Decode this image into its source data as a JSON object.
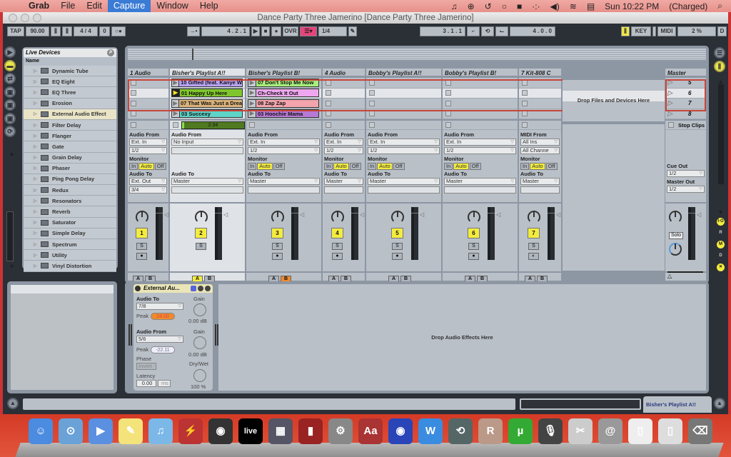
{
  "menubar": {
    "app": "Grab",
    "items": [
      "File",
      "Edit",
      "Capture",
      "Window",
      "Help"
    ],
    "active_item": "Capture",
    "clock": "Sun 10:22 PM",
    "battery": "(Charged)"
  },
  "window": {
    "title": "Dance Party Three Jamerino  [Dance Party Three Jamerino]"
  },
  "control_bar": {
    "tap": "TAP",
    "tempo": "90.00",
    "signature": "4 / 4",
    "metronome_value": "0",
    "follow_icon": "→•",
    "position": "4 .  2 .  1",
    "overdub": "OVR",
    "quantize": "1/4",
    "loop_start": "3 .  1 .  1",
    "loop_length": "4 .  0 .  0",
    "key": "KEY",
    "midi": "MIDI",
    "cpu": "2 %",
    "disk": "D"
  },
  "browser": {
    "title": "Live Devices",
    "column": "Name",
    "selected": "External Audio Effect",
    "items": [
      "Dynamic Tube",
      "EQ Eight",
      "EQ Three",
      "Erosion",
      "External Audio Effect",
      "Filter Delay",
      "Flanger",
      "Gate",
      "Grain Delay",
      "Phaser",
      "Ping Pong Delay",
      "Redux",
      "Resonators",
      "Reverb",
      "Saturator",
      "Simple Delay",
      "Spectrum",
      "Utility",
      "Vinyl Distortion"
    ]
  },
  "tracks": [
    {
      "name": "1 Audio",
      "clips": [
        null,
        null,
        null,
        null
      ],
      "from_label": "Audio From",
      "from": "Ext. In",
      "from_ch": "1/2",
      "monitor": true,
      "to": "Ext. Out",
      "to_ch": "3/4",
      "number": "1",
      "solo": "S",
      "arm": "●",
      "xfade": "none"
    },
    {
      "name": "Bisher's Playlist A!!",
      "clips": [
        {
          "name": "10 Gifted (feat. Kanye W",
          "color": "#b7a2f5"
        },
        {
          "name": "01 Happy Up Here",
          "color": "#7fc62c",
          "playing": true
        },
        {
          "name": "07 That Was Just a Drea",
          "color": "#d9b27a"
        },
        {
          "name": "03 Succexy",
          "color": "#5ed3c8"
        }
      ],
      "progress_label": "2:34",
      "progress": 0.04,
      "from_label": "Audio From",
      "from": "No Input",
      "monitor": false,
      "to": "Master",
      "number": "2",
      "solo": "S",
      "xfade": "A"
    },
    {
      "name": "Bisher's Playlist B!",
      "clips": [
        {
          "name": "07 Don't Stop Me Now",
          "color": "#a7ef7c"
        },
        {
          "name": "Ch-Check It Out",
          "color": "#eea7ee"
        },
        {
          "name": "08 Zap Zap",
          "color": "#f3a4ac"
        },
        {
          "name": "03 Hoochie Mama",
          "color": "#b779d6"
        }
      ],
      "from_label": "Audio From",
      "from": "Ext. In",
      "from_ch": "1/2",
      "monitor": true,
      "to": "Master",
      "number": "3",
      "solo": "S",
      "arm": "●",
      "xfade": "B"
    },
    {
      "name": "4 Audio",
      "from_label": "Audio From",
      "from": "Ext. In",
      "from_ch": "1/2",
      "monitor": true,
      "to": "Master",
      "number": "4",
      "solo": "S",
      "arm": "●",
      "xfade": "none"
    },
    {
      "name": "Bobby's Playlist A!!",
      "from_label": "Audio From",
      "from": "Ext. In",
      "from_ch": "1/2",
      "monitor": true,
      "to": "Master",
      "number": "5",
      "solo": "S",
      "arm": "●",
      "xfade": "none"
    },
    {
      "name": "Bobby's Playlist B!",
      "from_label": "Audio From",
      "from": "Ext. In",
      "from_ch": "1/2",
      "monitor": true,
      "to": "Master",
      "number": "6",
      "solo": "S",
      "arm": "●",
      "xfade": "none"
    },
    {
      "name": "7 Kit-808 C",
      "from_label": "MIDI From",
      "from": "All Ins",
      "from_ch": "All Channe",
      "monitor": true,
      "to": "Master",
      "number": "7",
      "solo": "S",
      "arm": "◐",
      "xfade": "none"
    }
  ],
  "labels": {
    "monitor": "Monitor",
    "audio_to": "Audio To",
    "in": "In",
    "auto": "Auto",
    "off": "Off",
    "a": "A",
    "b": "B",
    "drop_files": "Drop Files and Devices Here",
    "drop_fx": "Drop Audio Effects Here"
  },
  "master": {
    "name": "Master",
    "scenes": [
      "5",
      "6",
      "7",
      "8"
    ],
    "stop_clips": "Stop Clips",
    "cue_out_label": "Cue Out",
    "cue_out": "1/2",
    "master_out_label": "Master Out",
    "master_out": "1/2",
    "solo": "Solo"
  },
  "device": {
    "title": "External Au...",
    "audio_to_label": "Audio To",
    "audio_to": "7/8",
    "peak_label": "Peak",
    "peak_out": "24.00",
    "gain_label": "Gain",
    "gain_out": "0.00 dB",
    "audio_from_label": "Audio From",
    "audio_from": "5/6",
    "peak_in": "-22.11",
    "gain_in": "0.00 dB",
    "phase_label": "Phase",
    "invert": "Invert",
    "drywet_label": "Dry/Wet",
    "drywet": "100 %",
    "latency_label": "Latency",
    "latency": "0.00",
    "latency_unit": "ms"
  },
  "status": {
    "selected_track": "Bisher's Playlist A!!"
  },
  "dock": {
    "icons": [
      "finder-icon",
      "safari-icon",
      "ichat-icon",
      "stickies-icon",
      "itunes-icon",
      "reload-icon",
      "logic-icon",
      "ableton-live-icon",
      "reason-icon",
      "photobooth-icon",
      "system-preferences-icon",
      "dictionary-icon",
      "dvd-player-icon",
      "word-icon",
      "time-machine-icon",
      "rar-icon",
      "utorrent-icon",
      "microphone-icon",
      "preview-icon",
      "mail-icon",
      "doc-icon",
      "doc-icon-2",
      "trash-icon"
    ]
  }
}
